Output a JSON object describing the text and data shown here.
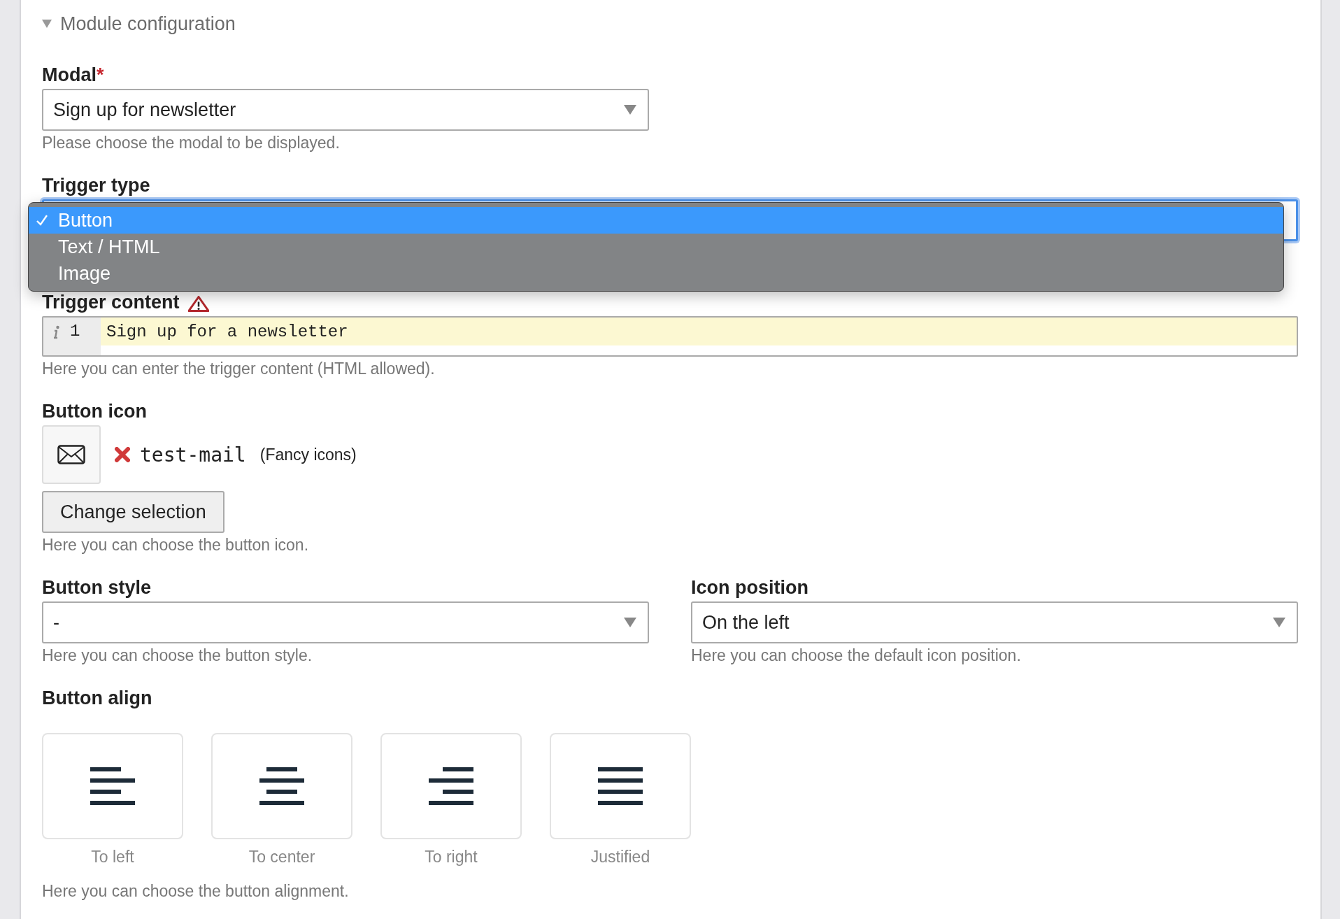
{
  "section": {
    "title": "Module configuration",
    "expanded": true
  },
  "modal": {
    "label": "Modal",
    "required_mark": "*",
    "value": "Sign up for newsletter",
    "help": "Please choose the modal to be displayed."
  },
  "trigger_type": {
    "label": "Trigger type",
    "open": true,
    "options": [
      {
        "label": "Button",
        "selected": true
      },
      {
        "label": "Text / HTML",
        "selected": false
      },
      {
        "label": "Image",
        "selected": false
      }
    ]
  },
  "trigger_content": {
    "label": "Trigger content",
    "line_number": "1",
    "code": "Sign up for a newsletter",
    "help": "Here you can enter the trigger content (HTML allowed)."
  },
  "button_icon": {
    "label": "Button icon",
    "icon_name": "test-mail",
    "library": "(Fancy icons)",
    "button": "Change selection",
    "help": "Here you can choose the button icon."
  },
  "button_style": {
    "label": "Button style",
    "value": "-",
    "help": "Here you can choose the button style."
  },
  "icon_position": {
    "label": "Icon position",
    "value": "On the left",
    "help": "Here you can choose the default icon position."
  },
  "button_align": {
    "label": "Button align",
    "options": [
      {
        "label": "To left",
        "kind": "left"
      },
      {
        "label": "To center",
        "kind": "center"
      },
      {
        "label": "To right",
        "kind": "right"
      },
      {
        "label": "Justified",
        "kind": "justify"
      }
    ],
    "help": "Here you can choose the button alignment."
  }
}
